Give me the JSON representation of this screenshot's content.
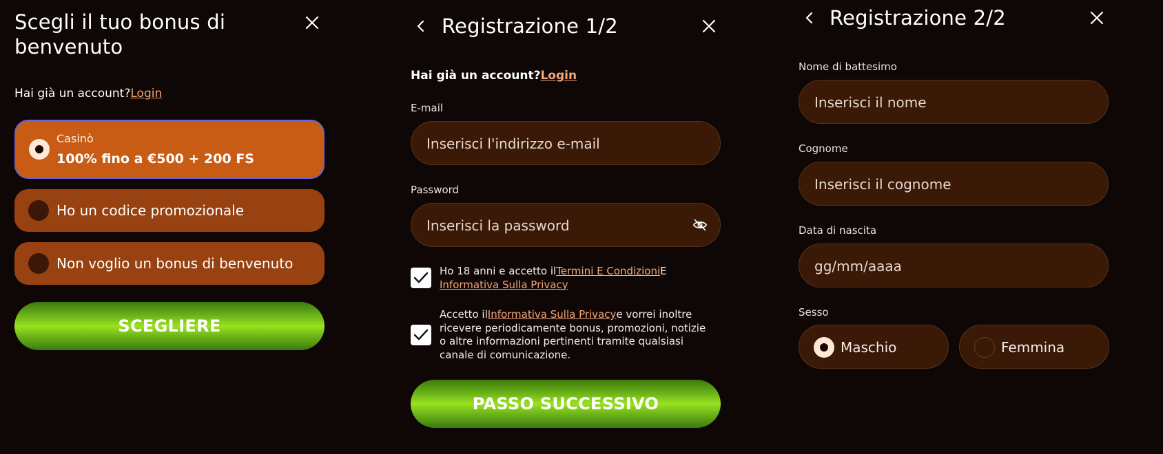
{
  "panel1": {
    "title": "Scegli il tuo bonus di benvenuto",
    "login_prompt": "Hai già un account?",
    "login_link": "Login",
    "options": [
      {
        "label": "Casinò",
        "sublabel": "100% fino a €500 + 200 FS",
        "selected": true
      },
      {
        "label": "Ho un codice promozionale",
        "selected": false
      },
      {
        "label": "Non voglio un bonus di benvenuto",
        "selected": false
      }
    ],
    "cta": "SCEGLIERE"
  },
  "panel2": {
    "title": "Registrazione 1/2",
    "login_prompt": "Hai già un account?",
    "login_link": "Login",
    "email_label": "E-mail",
    "email_placeholder": "Inserisci l'indirizzo e-mail",
    "password_label": "Password",
    "password_placeholder": "Inserisci la password",
    "terms": {
      "prefix": "Ho 18 anni e accetto il",
      "link1": "Termini E Condizioni",
      "mid": "E ",
      "link2": "Informativa Sulla Privacy",
      "checked": true
    },
    "marketing": {
      "prefix": "Accetto il",
      "link": "Informativa Sulla Privacy",
      "suffix": "e vorrei inoltre ricevere periodicamente bonus, promozioni, notizie o altre informazioni pertinenti tramite qualsiasi canale di comunicazione.",
      "checked": true
    },
    "cta": "PASSO SUCCESSIVO"
  },
  "panel3": {
    "title": "Registrazione 2/2",
    "first_name_label": "Nome di battesimo",
    "first_name_placeholder": "Inserisci il nome",
    "last_name_label": "Cognome",
    "last_name_placeholder": "Inserisci il cognome",
    "dob_label": "Data di nascita",
    "dob_placeholder": "gg/mm/aaaa",
    "gender_label": "Sesso",
    "gender_options": [
      {
        "label": "Maschio",
        "selected": true
      },
      {
        "label": "Femmina",
        "selected": false
      }
    ]
  },
  "icons": {
    "close": "close-icon",
    "back": "chevron-left-icon",
    "eye": "eye-off-icon",
    "check": "checkmark-icon"
  },
  "colors": {
    "background": "#0e0705",
    "selected_option": "#c85c15",
    "option": "#984211",
    "field": "#3a1907",
    "link": "#f6a87a",
    "cta_green": "#9ae21f",
    "selected_border": "#6a63d8"
  }
}
